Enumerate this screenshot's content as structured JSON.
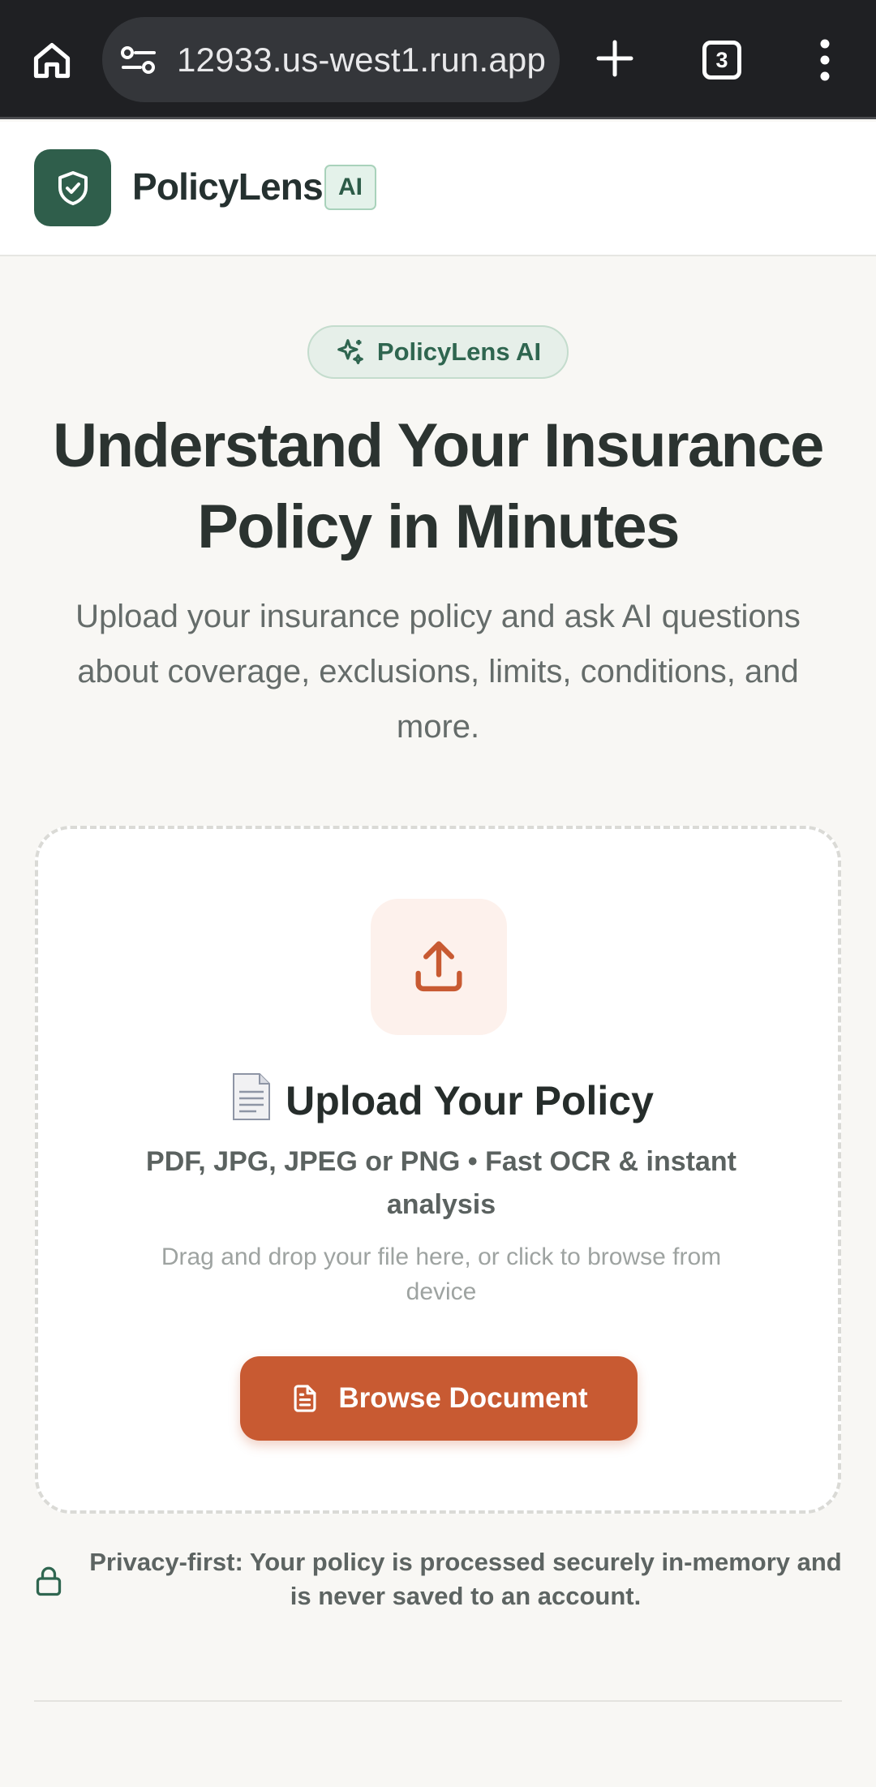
{
  "browser": {
    "url": "⁠⁠12933.us-west1.run.app",
    "tab_count": "3",
    "icons": {
      "home": "home-icon",
      "site_settings": "tune-icon",
      "new_tab": "plus-icon",
      "menu": "more-vert-icon"
    }
  },
  "header": {
    "brand": "PolicyLens",
    "badge": "AI",
    "logo_icon": "shield-check-icon"
  },
  "hero": {
    "pill_label": "PolicyLens AI",
    "pill_icon": "sparkles-icon",
    "title": "Understand Your Insurance Policy in Minutes",
    "subtitle": "Upload your insurance policy and ask AI questions about coverage, exclusions, limits, conditions, and more."
  },
  "upload": {
    "icon": "upload-icon",
    "title_emoji_icon": "page-document-icon",
    "title": "Upload Your Policy",
    "formats": "PDF, JPG, JPEG or PNG • Fast OCR & instant analysis",
    "hint": "Drag and drop your file here, or click to browse from device",
    "button_label": "Browse Document",
    "button_icon": "file-text-icon"
  },
  "privacy": {
    "icon": "lock-icon",
    "text": "Privacy-first: Your policy is processed securely in-memory and is never saved to an account."
  },
  "colors": {
    "brand_green": "#2f5e4b",
    "accent_orange": "#c85a32",
    "background": "#f8f7f4",
    "browser_bar": "#1f2023"
  }
}
